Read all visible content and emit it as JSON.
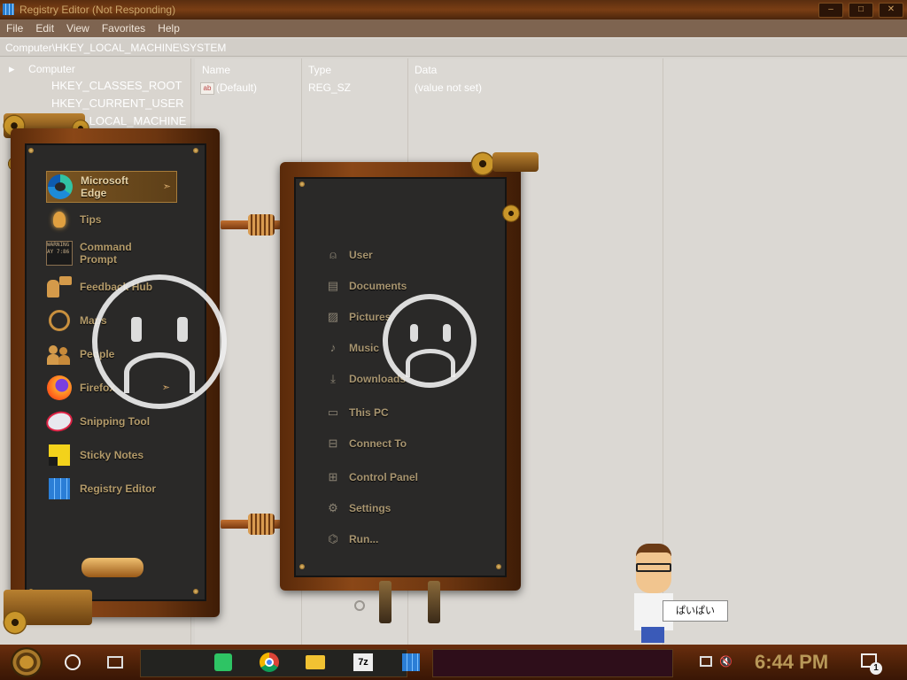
{
  "registry": {
    "title": "Registry Editor (Not Responding)",
    "menu": [
      "File",
      "Edit",
      "View",
      "Favorites",
      "Help"
    ],
    "address": "Computer\\HKEY_LOCAL_MACHINE\\SYSTEM",
    "tree": {
      "root": "Computer",
      "items": [
        "HKEY_CLASSES_ROOT",
        "HKEY_CURRENT_USER",
        "HKEY_LOCAL_MACHINE"
      ]
    },
    "columns": [
      "Name",
      "Type",
      "Data"
    ],
    "values": [
      {
        "name": "(Default)",
        "type": "REG_SZ",
        "data": "(value not set)"
      }
    ]
  },
  "start_menu": {
    "apps": [
      {
        "label": "Microsoft Edge",
        "icon": "edge-icon",
        "active": true,
        "has_arrow": true
      },
      {
        "label": "Tips",
        "icon": "lightbulb-icon"
      },
      {
        "label": "Command Prompt",
        "icon": "command-prompt-icon",
        "icon_text": "WARNING AY 7:86"
      },
      {
        "label": "Feedback Hub",
        "icon": "feedback-icon"
      },
      {
        "label": "Maps",
        "icon": "maps-icon"
      },
      {
        "label": "People",
        "icon": "people-icon"
      },
      {
        "label": "Firefox",
        "icon": "firefox-icon",
        "has_arrow": true
      },
      {
        "label": "Snipping Tool",
        "icon": "snipping-tool-icon"
      },
      {
        "label": "Sticky Notes",
        "icon": "sticky-notes-icon"
      },
      {
        "label": "Registry Editor",
        "icon": "registry-editor-icon"
      }
    ],
    "places": [
      {
        "label": "User",
        "icon": "user-icon"
      },
      {
        "label": "Documents",
        "icon": "document-icon"
      },
      {
        "label": "Pictures",
        "icon": "picture-icon"
      },
      {
        "label": "Music",
        "icon": "music-note-icon"
      },
      {
        "label": "Downloads",
        "icon": "download-icon"
      },
      {
        "label": "This PC",
        "icon": "monitor-icon"
      },
      {
        "label": "Connect To",
        "icon": "network-icon"
      },
      {
        "label": "Control Panel",
        "icon": "control-panel-icon"
      },
      {
        "label": "Settings",
        "icon": "gear-icon"
      },
      {
        "label": "Run...",
        "icon": "run-icon"
      }
    ],
    "arrow_glyph": "➣"
  },
  "speech_bubble": "ぱいぱい",
  "taskbar": {
    "pinned": [
      "search-icon",
      "task-view-icon",
      "green-app-icon",
      "chrome-icon",
      "file-explorer-icon",
      "7zip-icon",
      "registry-editor-icon"
    ],
    "seven_zip_label": "7z",
    "clock": "6:44 PM",
    "notification_count": "1"
  },
  "colors": {
    "frame_wood": "#8a4717",
    "panel_bg": "#2a2928",
    "label_gold": "#b49b6a",
    "clock_gold": "#b89858",
    "taskbar": "#4a1f07"
  }
}
